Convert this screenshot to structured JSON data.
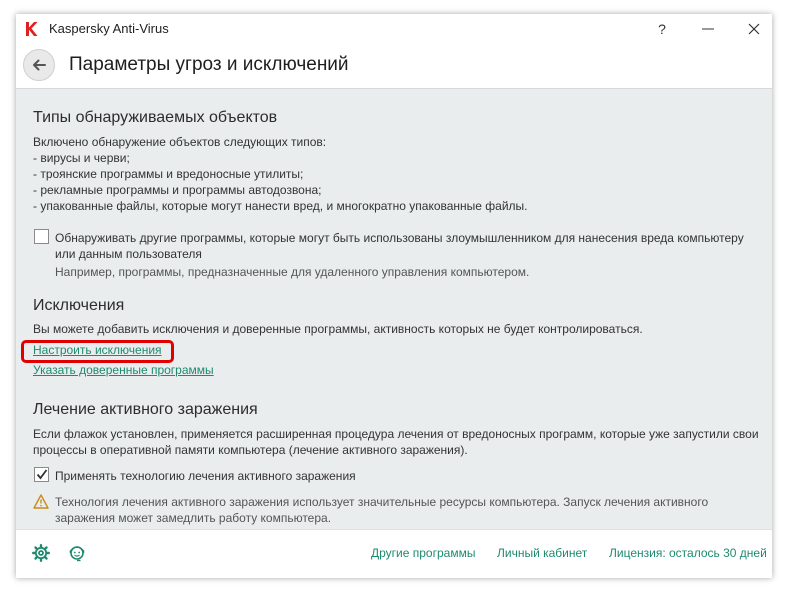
{
  "window": {
    "title": "Kaspersky Anti-Virus",
    "help_glyph": "?",
    "minimize_glyph": "—",
    "close_glyph": "✕"
  },
  "header": {
    "title": "Параметры угроз и исключений"
  },
  "detection": {
    "title": "Типы обнаруживаемых объектов",
    "intro": "Включено обнаружение объектов следующих типов:",
    "items": [
      "- вирусы и черви;",
      "- троянские программы и вредоносные утилиты;",
      "- рекламные программы и программы автодозвона;",
      "- упакованные файлы, которые могут нанести вред, и многократно упакованные файлы."
    ],
    "other_programs_checkbox": {
      "checked": false,
      "label_line1": "Обнаруживать другие программы, которые могут быть использованы злоумышленником для нанесения вреда компьютеру",
      "label_line2": "или данным пользователя",
      "hint": "Например, программы, предназначенные для удаленного управления компьютером."
    }
  },
  "exclusions": {
    "title": "Исключения",
    "description": "Вы можете добавить исключения и доверенные программы, активность которых не будет контролироваться.",
    "configure_link": "Настроить исключения",
    "trusted_link": "Указать доверенные программы"
  },
  "disinfection": {
    "title": "Лечение активного заражения",
    "description_line1": "Если флажок установлен, применяется расширенная процедура лечения от вредоносных программ, которые уже запустили свои",
    "description_line2": "процессы в оперативной памяти компьютера (лечение активного заражения).",
    "checkbox": {
      "checked": true,
      "label": "Применять технологию лечения активного заражения"
    },
    "warning_line1": "Технология лечения активного заражения использует значительные ресурсы компьютера. Запуск лечения активного",
    "warning_line2": "заражения может замедлить работу компьютера."
  },
  "footer": {
    "icons": [
      "gear-icon",
      "support-agent-icon"
    ],
    "other_programs": "Другие программы",
    "my_account": "Личный кабинет",
    "license": "Лицензия: осталось 30 дней"
  },
  "colors": {
    "link": "#1f8a70",
    "content_bg": "#e9edee",
    "highlight": "#e00000",
    "warning": "#c98a1c",
    "logo": "#e02020"
  }
}
